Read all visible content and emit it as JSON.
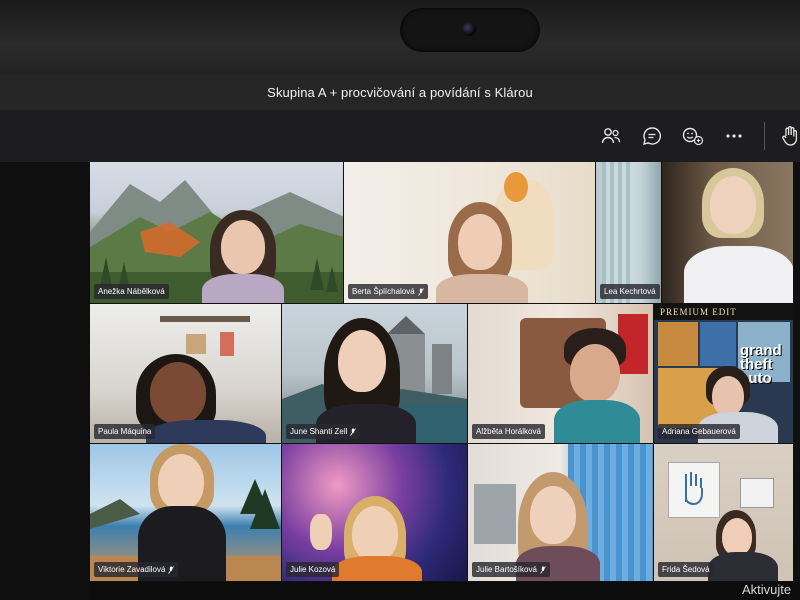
{
  "window": {
    "title": "Skupina A + procvičování a povídání s Klárou"
  },
  "toolbar": {
    "icons": [
      "participants-icon",
      "chat-icon",
      "reactions-icon",
      "more-options-icon",
      "raise-hand-icon"
    ]
  },
  "participants": [
    {
      "name": "Anežka Nábělková",
      "muted": false,
      "background": "mountain-landscape"
    },
    {
      "name": "Berta Šplíchalová",
      "muted": true,
      "background": "room-with-cat"
    },
    {
      "name": "Lea Kechrtová",
      "muted": false,
      "background": "curtain-room"
    },
    {
      "name": "",
      "muted": false,
      "background": "bedroom"
    },
    {
      "name": "Paula Máquina",
      "muted": false,
      "background": "kitchen"
    },
    {
      "name": "June Shanti Zell",
      "muted": true,
      "background": "castle-landscape"
    },
    {
      "name": "Alžběta Horálková",
      "muted": false,
      "background": "living-room"
    },
    {
      "name": "Adriana Gebauerová",
      "muted": false,
      "background": "game-poster"
    },
    {
      "name": "Viktorie Zavadilová",
      "muted": true,
      "background": "beach"
    },
    {
      "name": "Julie Kozová",
      "muted": false,
      "background": "galaxy"
    },
    {
      "name": "Julie Bartošíková",
      "muted": true,
      "background": "blue-curtain-room"
    },
    {
      "name": "Frida Šedová",
      "muted": false,
      "background": "drawing-wall"
    }
  ],
  "poster_text": {
    "banner": "PREMIUM EDIT",
    "logo": "grand theft auto"
  },
  "watermark": "Aktivujte"
}
